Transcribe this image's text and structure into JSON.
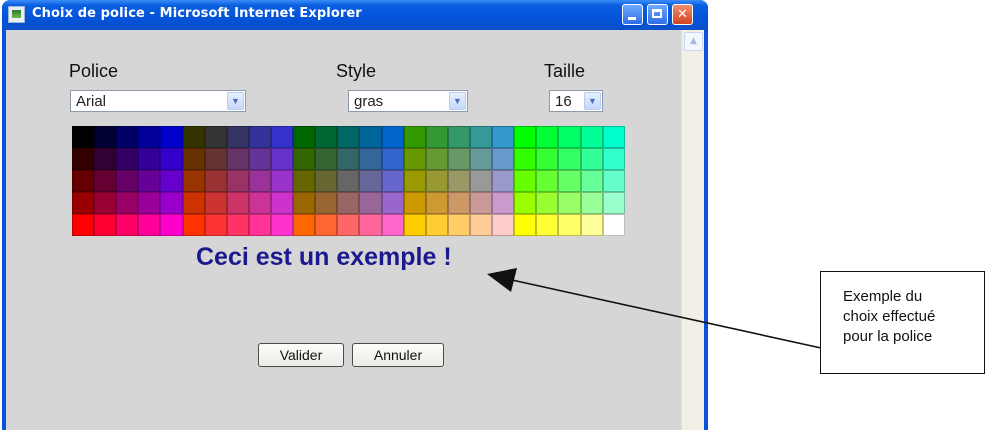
{
  "window": {
    "title": "Choix de police - Microsoft Internet Explorer"
  },
  "form": {
    "police_label": "Police",
    "style_label": "Style",
    "taille_label": "Taille",
    "police_value": "Arial",
    "style_value": "gras",
    "taille_value": "16",
    "sample_text": "Ceci est un exemple !",
    "valider": "Valider",
    "annuler": "Annuler"
  },
  "palette": {
    "rows": [
      [
        "#000000",
        "#000033",
        "#000066",
        "#000099",
        "#0000cc",
        "#333300",
        "#333333",
        "#333366",
        "#333399",
        "#3333cc",
        "#006600",
        "#006633",
        "#006666",
        "#006699",
        "#0066cc",
        "#339900",
        "#339933",
        "#339966",
        "#339999",
        "#3399cc",
        "#00ff00",
        "#00ff33",
        "#00ff66",
        "#00ff99",
        "#00ffcc"
      ],
      [
        "#330000",
        "#330033",
        "#330066",
        "#330099",
        "#3300cc",
        "#663300",
        "#663333",
        "#663366",
        "#663399",
        "#6633cc",
        "#336600",
        "#336633",
        "#336666",
        "#336699",
        "#3366cc",
        "#669900",
        "#669933",
        "#669966",
        "#669999",
        "#6699cc",
        "#33ff00",
        "#33ff33",
        "#33ff66",
        "#33ff99",
        "#33ffcc"
      ],
      [
        "#660000",
        "#660033",
        "#660066",
        "#660099",
        "#6600cc",
        "#993300",
        "#993333",
        "#993366",
        "#993399",
        "#9933cc",
        "#666600",
        "#666633",
        "#666666",
        "#666699",
        "#6666cc",
        "#999900",
        "#999933",
        "#999966",
        "#999999",
        "#9999cc",
        "#66ff00",
        "#66ff33",
        "#66ff66",
        "#66ff99",
        "#66ffcc"
      ],
      [
        "#990000",
        "#990033",
        "#990066",
        "#990099",
        "#9900cc",
        "#cc3300",
        "#cc3333",
        "#cc3366",
        "#cc3399",
        "#cc33cc",
        "#996600",
        "#996633",
        "#996666",
        "#996699",
        "#9966cc",
        "#cc9900",
        "#cc9933",
        "#cc9966",
        "#cc9999",
        "#cc99cc",
        "#99ff00",
        "#99ff33",
        "#99ff66",
        "#99ff99",
        "#99ffcc"
      ],
      [
        "#ff0000",
        "#ff0033",
        "#ff0066",
        "#ff0099",
        "#ff00cc",
        "#ff3300",
        "#ff3333",
        "#ff3366",
        "#ff3399",
        "#ff33cc",
        "#ff6600",
        "#ff6633",
        "#ff6666",
        "#ff6699",
        "#ff66cc",
        "#ffcc00",
        "#ffcc33",
        "#ffcc66",
        "#ffcc99",
        "#ffcccc",
        "#ffff00",
        "#ffff33",
        "#ffff66",
        "#ffff99",
        "#ffffff"
      ]
    ]
  },
  "annotation": {
    "lines": [
      "Exemple du",
      "choix effectué",
      "pour la police"
    ]
  }
}
